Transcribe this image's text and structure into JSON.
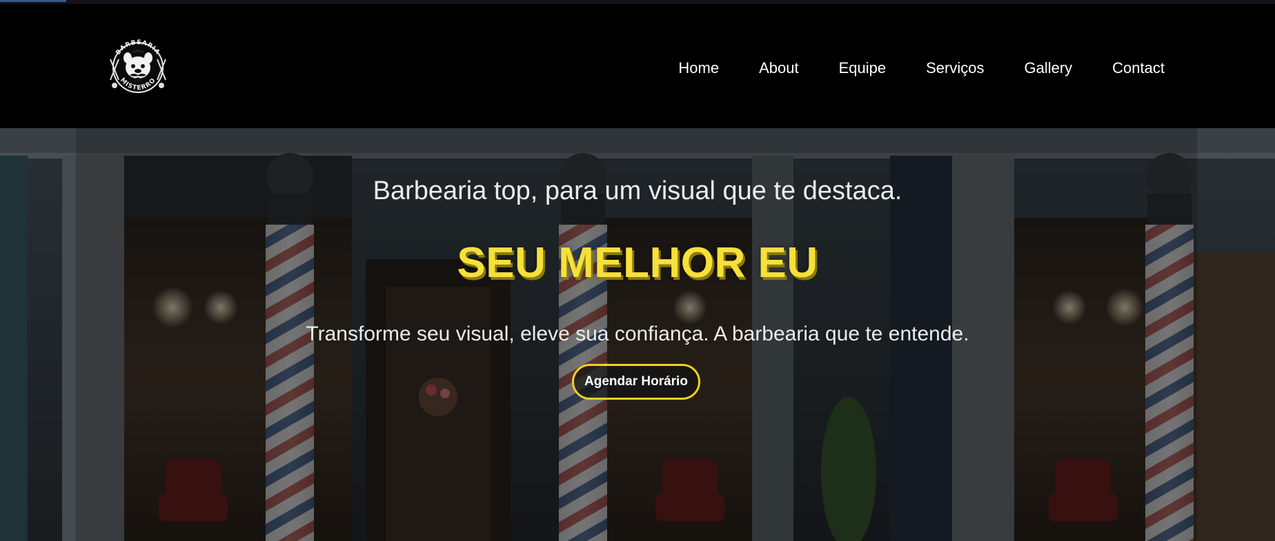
{
  "logo": {
    "arc_top": "BARBEARIA",
    "arc_bottom": "MISTERRO",
    "icon": "bulldog-barber-logo"
  },
  "nav": {
    "items": [
      {
        "label": "Home"
      },
      {
        "label": "About"
      },
      {
        "label": "Equipe"
      },
      {
        "label": "Serviços"
      },
      {
        "label": "Gallery"
      },
      {
        "label": "Contact"
      }
    ]
  },
  "hero": {
    "subtitle": "Barbearia top, para um visual que te destaca.",
    "headline": "SEU MELHOR EU",
    "tagline": "Transforme seu visual, eleve sua confiança. A barbearia que te entende.",
    "cta_label": "Agendar Horário"
  },
  "colors": {
    "accent": "#f2d21d",
    "header_bg": "#000000",
    "text": "#ececec"
  }
}
